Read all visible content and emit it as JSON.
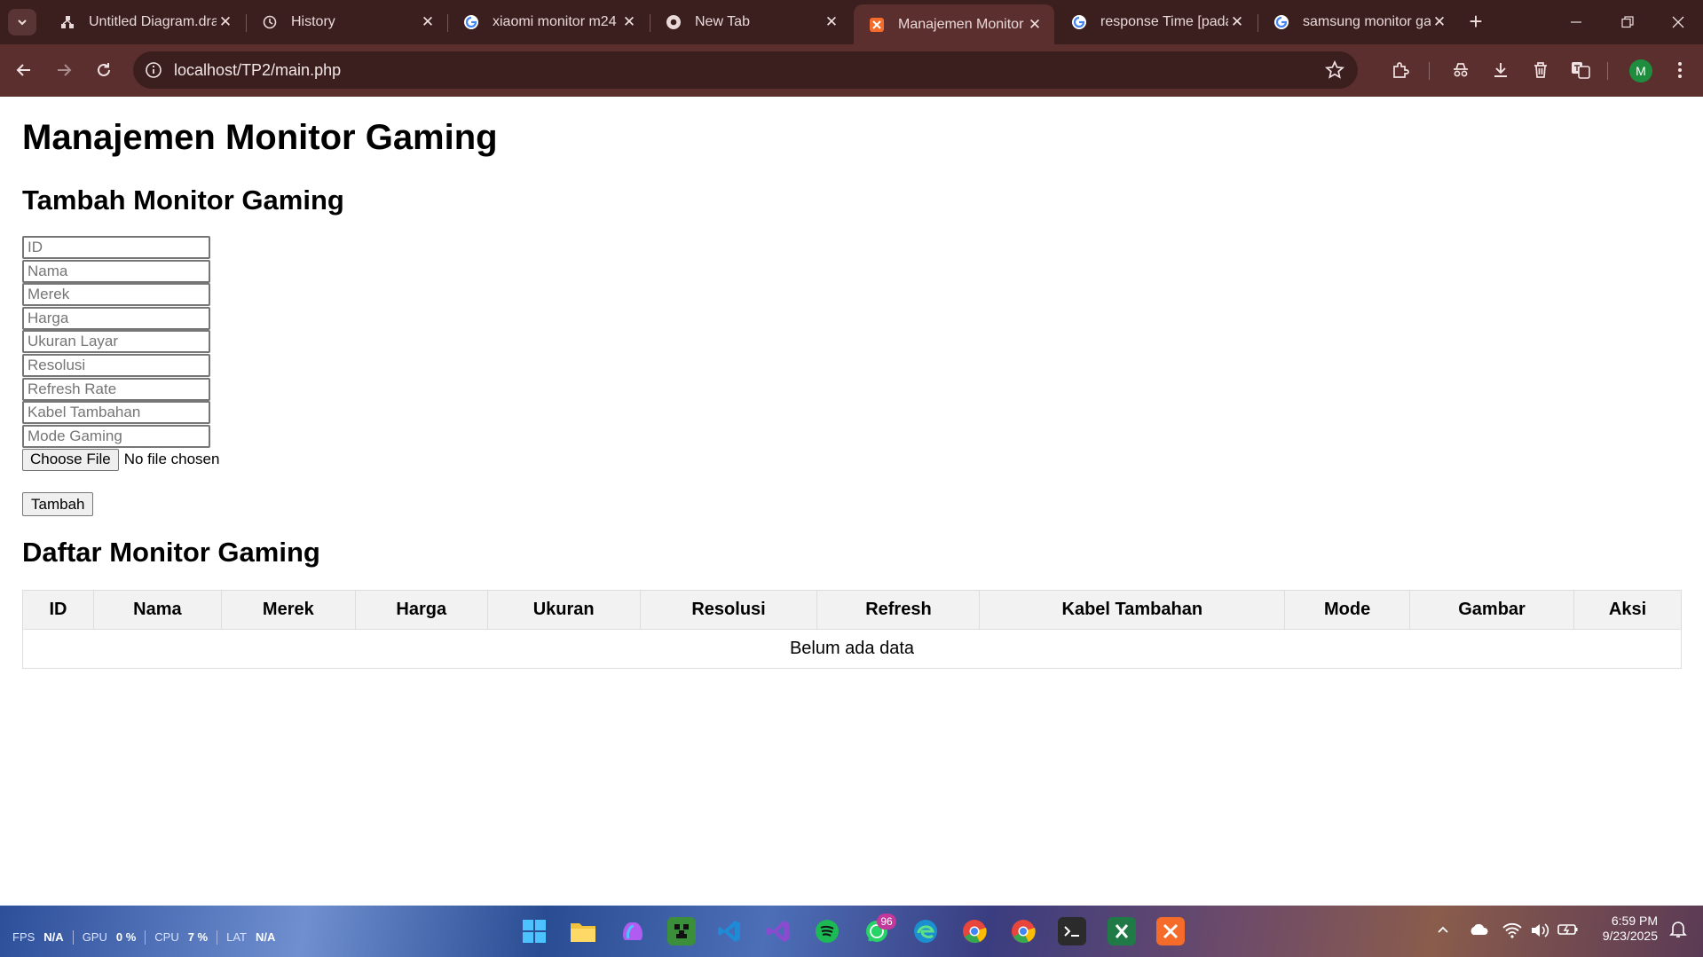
{
  "browser": {
    "tabs": [
      {
        "title": "Untitled Diagram.drawio",
        "icon": "drawio-icon"
      },
      {
        "title": "History",
        "icon": "history-icon"
      },
      {
        "title": "xiaomi monitor m24",
        "icon": "google-icon"
      },
      {
        "title": "New Tab",
        "icon": "chrome-icon"
      },
      {
        "title": "Manajemen Monitor Gaming",
        "icon": "xampp-icon"
      },
      {
        "title": "response Time [pada",
        "icon": "google-icon"
      },
      {
        "title": "samsung monitor gaming",
        "icon": "google-icon"
      }
    ],
    "active_tab_index": 4,
    "tab_close_glyph": "✕",
    "new_tab_glyph": "+",
    "url": "localhost/TP2/main.php",
    "profile_initial": "M"
  },
  "page": {
    "title": "Manajemen Monitor Gaming",
    "form_heading": "Tambah Monitor Gaming",
    "fields": [
      {
        "placeholder": "ID",
        "value": ""
      },
      {
        "placeholder": "Nama",
        "value": ""
      },
      {
        "placeholder": "Merek",
        "value": ""
      },
      {
        "placeholder": "Harga",
        "value": ""
      },
      {
        "placeholder": "Ukuran Layar",
        "value": ""
      },
      {
        "placeholder": "Resolusi",
        "value": ""
      },
      {
        "placeholder": "Refresh Rate",
        "value": ""
      },
      {
        "placeholder": "Kabel Tambahan",
        "value": ""
      },
      {
        "placeholder": "Mode Gaming",
        "value": ""
      }
    ],
    "file_button": "Choose File",
    "file_status": "No file chosen",
    "submit_label": "Tambah",
    "list_heading": "Daftar Monitor Gaming",
    "table_headers": [
      "ID",
      "Nama",
      "Merek",
      "Harga",
      "Ukuran",
      "Resolusi",
      "Refresh",
      "Kabel Tambahan",
      "Mode",
      "Gambar",
      "Aksi"
    ],
    "empty_message": "Belum ada data"
  },
  "taskbar": {
    "perf": [
      {
        "label": "FPS",
        "value": "N/A"
      },
      {
        "label": "GPU",
        "value": "0 %"
      },
      {
        "label": "CPU",
        "value": "7 %"
      },
      {
        "label": "LAT",
        "value": "N/A"
      }
    ],
    "apps": [
      {
        "name": "windows-start-icon",
        "color": "#3aa0ff"
      },
      {
        "name": "file-explorer-icon",
        "color": "#f2c33c"
      },
      {
        "name": "copilot-icon",
        "color": "#b15cf0"
      },
      {
        "name": "minecraft-icon",
        "color": "#3c8f3a"
      },
      {
        "name": "vscode-icon",
        "color": "#1f8ad6"
      },
      {
        "name": "visual-studio-icon",
        "color": "#8a4bd1"
      },
      {
        "name": "spotify-icon",
        "color": "#1db954"
      },
      {
        "name": "whatsapp-icon",
        "color": "#25d366"
      },
      {
        "name": "edge-icon",
        "color": "#1b8fd0"
      },
      {
        "name": "chrome-icon",
        "color": "#e8453c"
      },
      {
        "name": "chrome-profile-icon",
        "color": "#e8453c"
      },
      {
        "name": "terminal-icon",
        "color": "#2b2b2b"
      },
      {
        "name": "excel-icon",
        "color": "#1f7a45"
      },
      {
        "name": "xampp-icon",
        "color": "#f46b2a"
      }
    ],
    "whatsapp_badge": "96",
    "time": "6:59 PM",
    "date": "9/23/2025"
  }
}
